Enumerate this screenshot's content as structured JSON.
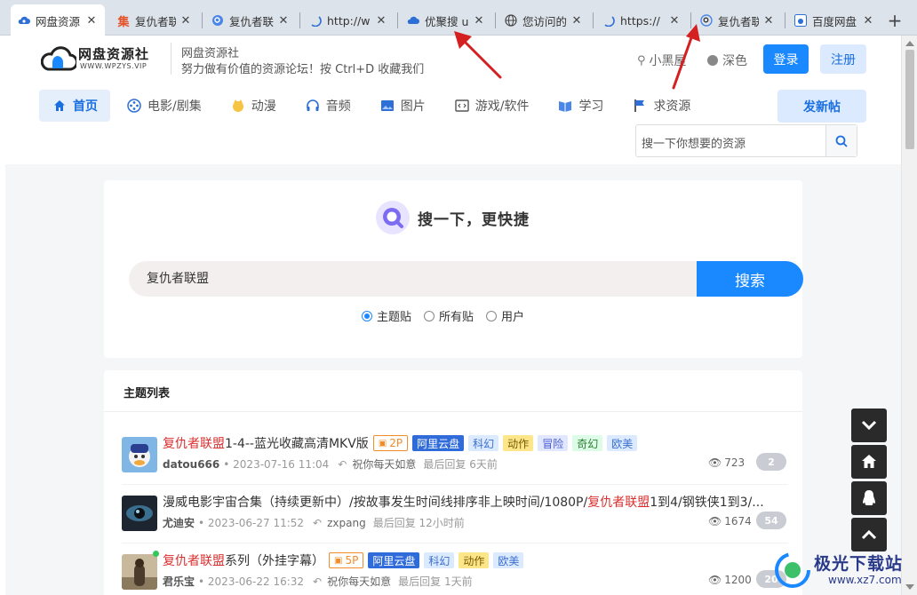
{
  "browser": {
    "tabs": [
      {
        "title": "网盘资源",
        "icon": "cloud-eye-icon",
        "active": true
      },
      {
        "title": "复仇者联",
        "icon": "ji-icon"
      },
      {
        "title": "复仇者联",
        "icon": "search-q-icon"
      },
      {
        "title": "http://w",
        "icon": "loading-icon"
      },
      {
        "title": "优聚搜 u",
        "icon": "cloud-icon"
      },
      {
        "title": "您访问的",
        "icon": "globe-icon"
      },
      {
        "title": "https://",
        "icon": "loading-icon"
      },
      {
        "title": "复仇者联",
        "icon": "search-q-icon"
      },
      {
        "title": "百度网盘",
        "icon": "baidu-icon"
      }
    ],
    "new_tab": "+"
  },
  "header": {
    "logo_name": "网盘资源社",
    "logo_url": "WWW.WPZYS.VIP",
    "site_name": "网盘资源社",
    "slogan": "努力做有价值的资源论坛！按 Ctrl+D 收藏我们",
    "link_blackroom": "小黑屋",
    "link_dark": "深色",
    "login": "登录",
    "register": "注册",
    "post_button": "发新帖",
    "search_placeholder": "搜一下你想要的资源"
  },
  "nav": [
    {
      "label": "首页",
      "icon": "home-icon",
      "active": true
    },
    {
      "label": "电影/剧集",
      "icon": "film-reel-icon"
    },
    {
      "label": "动漫",
      "icon": "anime-icon"
    },
    {
      "label": "音频",
      "icon": "headphones-icon"
    },
    {
      "label": "图片",
      "icon": "image-icon"
    },
    {
      "label": "游戏/软件",
      "icon": "code-window-icon"
    },
    {
      "label": "学习",
      "icon": "book-icon"
    },
    {
      "label": "求资源",
      "icon": "flag-icon"
    }
  ],
  "search_card": {
    "title": "搜一下，更快捷",
    "query": "复仇者联盟",
    "button": "搜索",
    "options": [
      {
        "label": "主题贴",
        "checked": true
      },
      {
        "label": "所有贴",
        "checked": false
      },
      {
        "label": "用户",
        "checked": false
      }
    ]
  },
  "topics": {
    "heading": "主题列表",
    "rows": [
      {
        "title_highlight": "复仇者联盟",
        "title_rest": "1-4--蓝光收藏高清MKV版",
        "tags": [
          {
            "text": "2P",
            "cls": "p"
          },
          {
            "text": "阿里云盘",
            "cls": "ali"
          },
          {
            "text": "科幻",
            "cls": "kh"
          },
          {
            "text": "动作",
            "cls": "dz"
          },
          {
            "text": "冒险",
            "cls": "mx"
          },
          {
            "text": "奇幻",
            "cls": "qh"
          },
          {
            "text": "欧美",
            "cls": "om"
          }
        ],
        "author": "datou666",
        "date": "• 2023-07-16 11:04",
        "replier": "祝你每天如意",
        "last_reply": "最后回复 6天前",
        "views": "723",
        "replies": "2"
      },
      {
        "title_pre": "漫威电影宇宙合集（持续更新中）/按故事发生时间线排序非上映时间/1080P/",
        "title_highlight": "复仇者联盟",
        "title_rest": "1到4/钢铁侠1到3/...",
        "tags": [],
        "author": "尤迪安",
        "date": "• 2023-06-27 11:52",
        "replier": "zxpang",
        "last_reply": "最后回复 12小时前",
        "views": "1674",
        "replies": "54"
      },
      {
        "title_highlight": "复仇者联盟",
        "title_rest": "系列（外挂字幕）",
        "tags": [
          {
            "text": "5P",
            "cls": "p"
          },
          {
            "text": "阿里云盘",
            "cls": "ali"
          },
          {
            "text": "科幻",
            "cls": "kh"
          },
          {
            "text": "动作",
            "cls": "dz"
          },
          {
            "text": "欧美",
            "cls": "om"
          }
        ],
        "author": "君乐宝",
        "date": "• 2023-06-22 16:32",
        "replier": "祝你每天如意",
        "last_reply": "最后回复 1天前",
        "views": "1200",
        "replies": "20"
      }
    ]
  },
  "float_buttons": [
    "chevron-down-icon",
    "home-icon",
    "qq-icon",
    "chevron-up-icon"
  ],
  "watermark": {
    "name": "极光下载站",
    "url": "www.xz7.com"
  },
  "colors": {
    "accent": "#1a88ff",
    "highlight": "#d9302f",
    "annotation_arrow": "#d42020"
  }
}
